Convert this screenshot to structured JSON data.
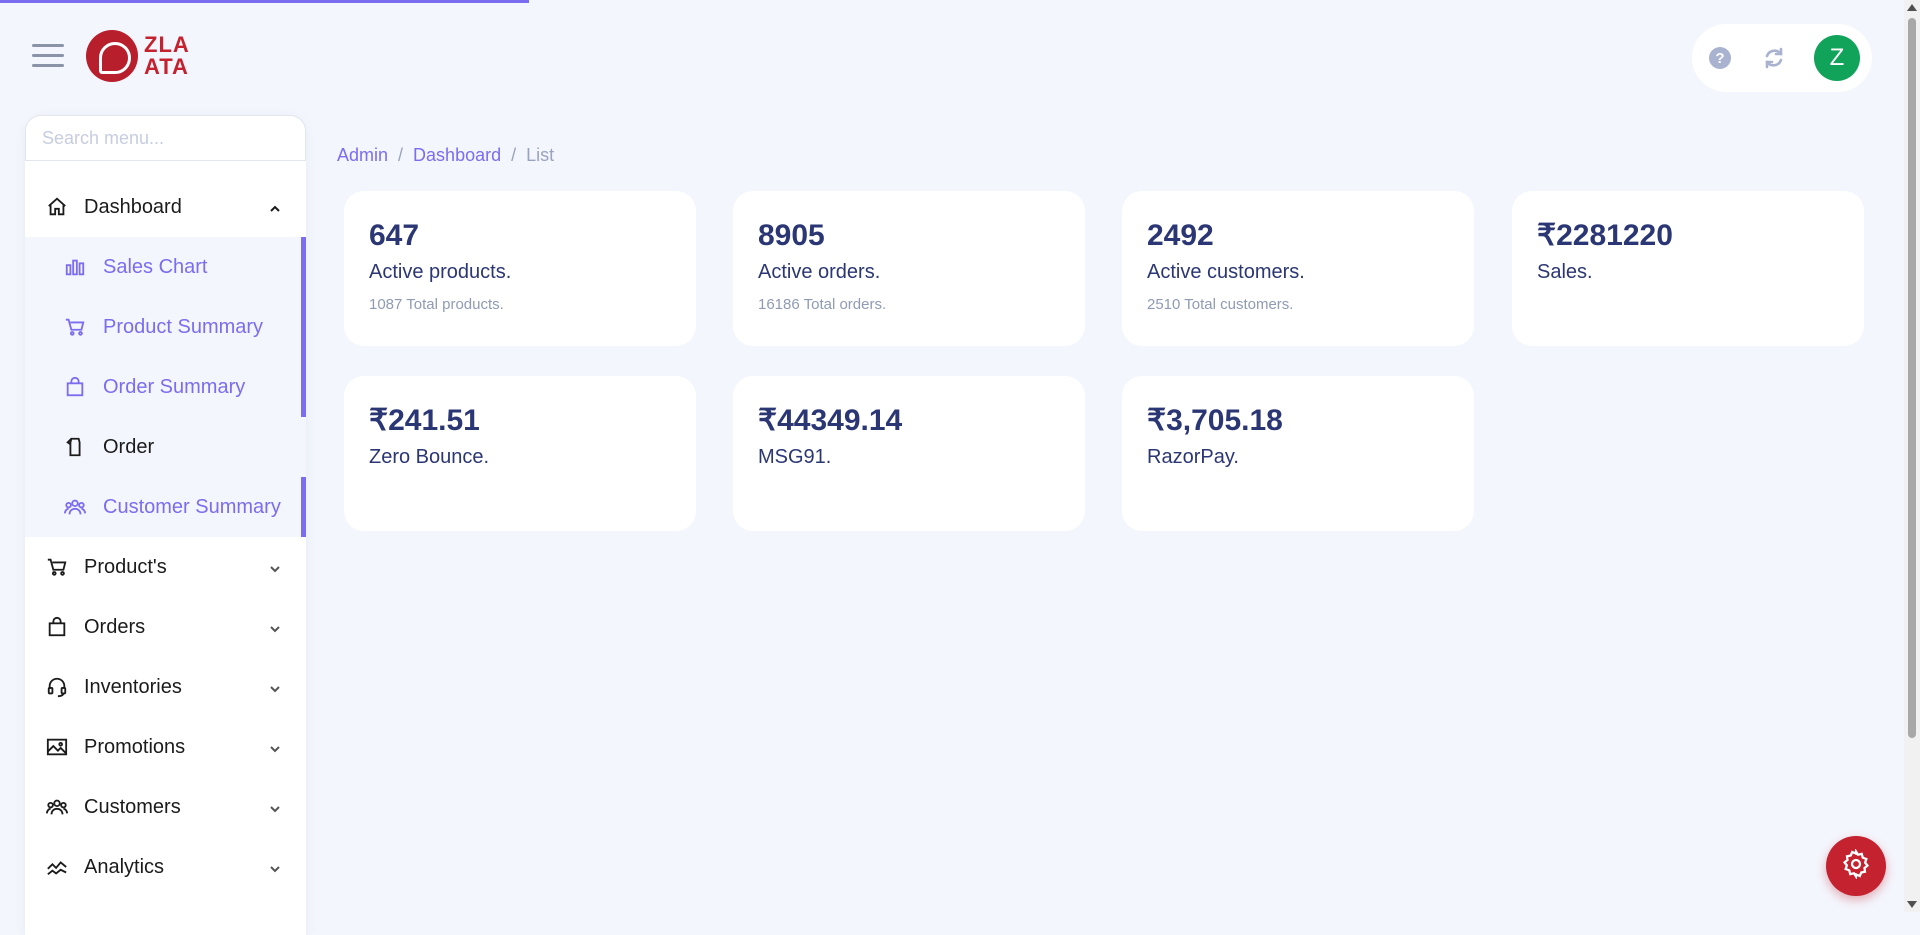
{
  "brand": {
    "logo_text_line1": "ZLA",
    "logo_text_line2": "ATA"
  },
  "header": {
    "avatar_letter": "Z",
    "help_icon": "help-icon",
    "refresh_icon": "refresh-icon"
  },
  "sidebar": {
    "search_placeholder": "Search menu...",
    "dashboard": {
      "label": "Dashboard",
      "children": [
        {
          "label": "Sales Chart",
          "icon": "bar-chart-icon"
        },
        {
          "label": "Product Summary",
          "icon": "cart-icon"
        },
        {
          "label": "Order Summary",
          "icon": "bag-icon"
        },
        {
          "label": "Order",
          "icon": "shirt-icon"
        },
        {
          "label": "Customer Summary",
          "icon": "users-icon"
        }
      ]
    },
    "items": [
      {
        "label": "Product's",
        "icon": "cart-icon"
      },
      {
        "label": "Orders",
        "icon": "bag-icon"
      },
      {
        "label": "Inventories",
        "icon": "headset-icon"
      },
      {
        "label": "Promotions",
        "icon": "image-icon"
      },
      {
        "label": "Customers",
        "icon": "users-icon"
      },
      {
        "label": "Analytics",
        "icon": "trend-icon"
      }
    ]
  },
  "breadcrumb": {
    "items": [
      "Admin",
      "Dashboard",
      "List"
    ],
    "separator": "/"
  },
  "cards": [
    {
      "value": "647",
      "label": "Active products.",
      "sub": "1087 Total products."
    },
    {
      "value": "8905",
      "label": "Active orders.",
      "sub": "16186 Total orders."
    },
    {
      "value": "2492",
      "label": "Active customers.",
      "sub": "2510 Total customers."
    },
    {
      "value": "₹2281220",
      "label": "Sales.",
      "sub": ""
    },
    {
      "value": "₹241.51",
      "label": "Zero Bounce.",
      "sub": ""
    },
    {
      "value": "₹44349.14",
      "label": "MSG91.",
      "sub": ""
    },
    {
      "value": "₹3,705.18",
      "label": "RazorPay.",
      "sub": ""
    }
  ],
  "colors": {
    "accent": "#7b6cf0",
    "brand_red": "#c4222f",
    "avatar_green": "#11a35a",
    "text_dark": "#2b3674"
  }
}
